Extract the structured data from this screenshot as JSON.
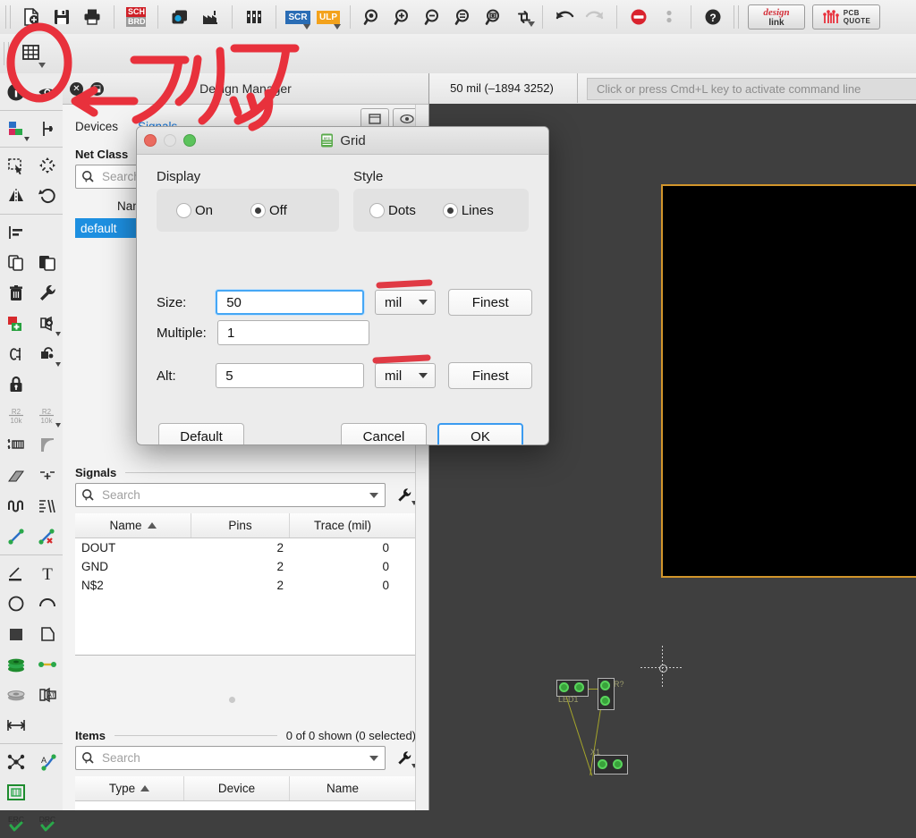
{
  "toolbar": {
    "buttons": [
      {
        "name": "new-button",
        "label": "New"
      },
      {
        "name": "save-button",
        "label": "Save"
      },
      {
        "name": "print-button",
        "label": "Print"
      },
      {
        "name": "sch-brd-switch-button",
        "label": "SCH\nBRD"
      },
      {
        "name": "cam-processor-button",
        "label": "CAM Processor"
      },
      {
        "name": "manufacturing-button",
        "label": "Manufacturing"
      },
      {
        "name": "library-button",
        "label": "Library"
      },
      {
        "name": "script-button",
        "label": "SCR"
      },
      {
        "name": "ulp-button",
        "label": "ULP"
      },
      {
        "name": "zoom-fit-button",
        "label": "Zoom to fit"
      },
      {
        "name": "zoom-in-button",
        "label": "Zoom in"
      },
      {
        "name": "zoom-out-button",
        "label": "Zoom out"
      },
      {
        "name": "zoom-select-button",
        "label": "Zoom select"
      },
      {
        "name": "zoom-options-button",
        "label": "Zoom options"
      },
      {
        "name": "redraw-button",
        "label": "Redraw"
      },
      {
        "name": "undo-button",
        "label": "Undo"
      },
      {
        "name": "redo-button",
        "label": "Redo"
      },
      {
        "name": "stop-button",
        "label": "Stop"
      },
      {
        "name": "more-button",
        "label": "More"
      },
      {
        "name": "help-button",
        "label": "Help"
      }
    ],
    "design_link_label_1": "design",
    "design_link_label_2": "link",
    "pcb_quote_label_1": "PCB",
    "pcb_quote_label_2": "QUOTE",
    "grid_button_label": "Grid"
  },
  "statusbar": {
    "coordinates": "50 mil (–1894 3252)",
    "command_placeholder": "Click or press Cmd+L key to activate command line"
  },
  "design_manager": {
    "title": "Design Manager",
    "tabs": [
      {
        "label": "Devices",
        "active": false
      },
      {
        "label": "Signals",
        "active": true
      }
    ],
    "net_class": {
      "label": "Net Class",
      "search_placeholder": "Search",
      "columns": [
        "Name"
      ],
      "rows": [
        {
          "name": "default",
          "selected": true
        }
      ]
    },
    "signals": {
      "label": "Signals",
      "search_placeholder": "Search",
      "columns": [
        "Name",
        "Pins",
        "Trace (mil)"
      ],
      "sort_column": "Name",
      "rows": [
        {
          "name": "DOUT",
          "pins": "2",
          "trace": "0"
        },
        {
          "name": "GND",
          "pins": "2",
          "trace": "0"
        },
        {
          "name": "N$2",
          "pins": "2",
          "trace": "0"
        }
      ]
    },
    "items": {
      "label": "Items",
      "count": "0 of 0 shown (0 selected)",
      "search_placeholder": "Search",
      "columns": [
        "Type",
        "Device",
        "Name"
      ],
      "sort_column": "Type",
      "rows": []
    }
  },
  "grid_dialog": {
    "title": "Grid",
    "display": {
      "label": "Display",
      "options": [
        {
          "label": "On",
          "selected": false
        },
        {
          "label": "Off",
          "selected": true
        }
      ]
    },
    "style": {
      "label": "Style",
      "options": [
        {
          "label": "Dots",
          "selected": false
        },
        {
          "label": "Lines",
          "selected": true
        }
      ]
    },
    "size": {
      "label": "Size:",
      "value": "50",
      "unit": "mil",
      "finest_label": "Finest"
    },
    "multiple": {
      "label": "Multiple:",
      "value": "1"
    },
    "alt": {
      "label": "Alt:",
      "value": "5",
      "unit": "mil",
      "finest_label": "Finest"
    },
    "buttons": {
      "default_label": "Default",
      "cancel_label": "Cancel",
      "ok_label": "OK"
    }
  },
  "annotations": {
    "click_text": "←クリック",
    "ink_color": "#e8313c"
  },
  "canvas": {
    "board_outline_color": "#d2952b",
    "background_color": "#3f3f3f",
    "board_fill": "#000000",
    "components": [
      {
        "ref": "LED1"
      },
      {
        "ref": "R?"
      },
      {
        "ref": "X1"
      }
    ]
  }
}
